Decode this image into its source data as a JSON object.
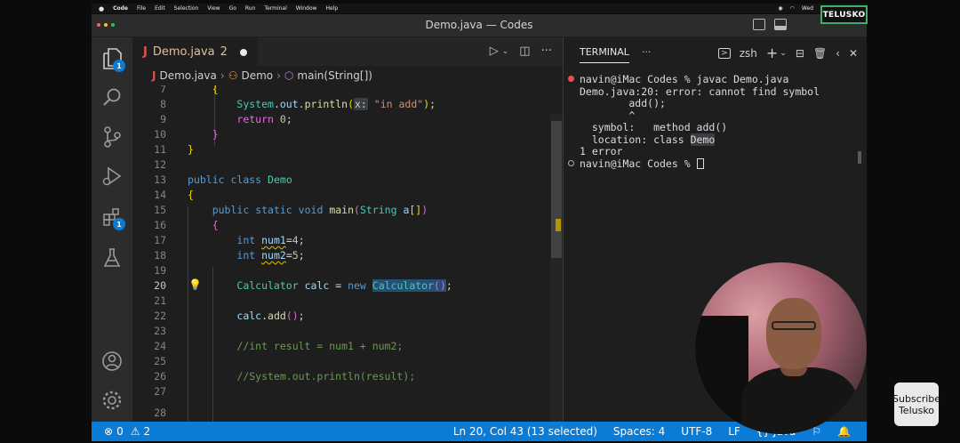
{
  "mac_menu": {
    "apple": "",
    "items": [
      "Code",
      "File",
      "Edit",
      "Selection",
      "View",
      "Go",
      "Run",
      "Terminal",
      "Window",
      "Help"
    ],
    "right": "Wed"
  },
  "window": {
    "title": "Demo.java — Codes"
  },
  "logo": "TELUSKO",
  "activity": {
    "explorer_badge": "1",
    "extensions_badge": "1"
  },
  "tab": {
    "name": "Demo.java",
    "count": "2"
  },
  "breadcrumb": {
    "file": "Demo.java",
    "class": "Demo",
    "method": "main(String[])"
  },
  "code": {
    "line_numbers": [
      "7",
      "8",
      "9",
      "10",
      "11",
      "12",
      "13",
      "14",
      "15",
      "16",
      "17",
      "18",
      "19",
      "20",
      "21",
      "22",
      "23",
      "24",
      "25",
      "26",
      "27",
      "28"
    ],
    "active_line": "20"
  },
  "terminal": {
    "tab_label": "TERMINAL",
    "more": "···",
    "shell": "zsh",
    "lines": [
      "navin@iMac Codes % javac Demo.java",
      "Demo.java:20: error: cannot find symbol",
      "        add();",
      "        ^",
      "  symbol:   method add()",
      "  location: class ",
      "Demo",
      "1 error",
      "navin@iMac Codes % "
    ]
  },
  "status": {
    "errors": "0",
    "warnings": "2",
    "position": "Ln 20, Col 43 (13 selected)",
    "spaces": "Spaces: 4",
    "encoding": "UTF-8",
    "eol": "LF",
    "language": "Java"
  },
  "subscribe": {
    "line1": "Subscribe",
    "line2": "Telusko"
  }
}
